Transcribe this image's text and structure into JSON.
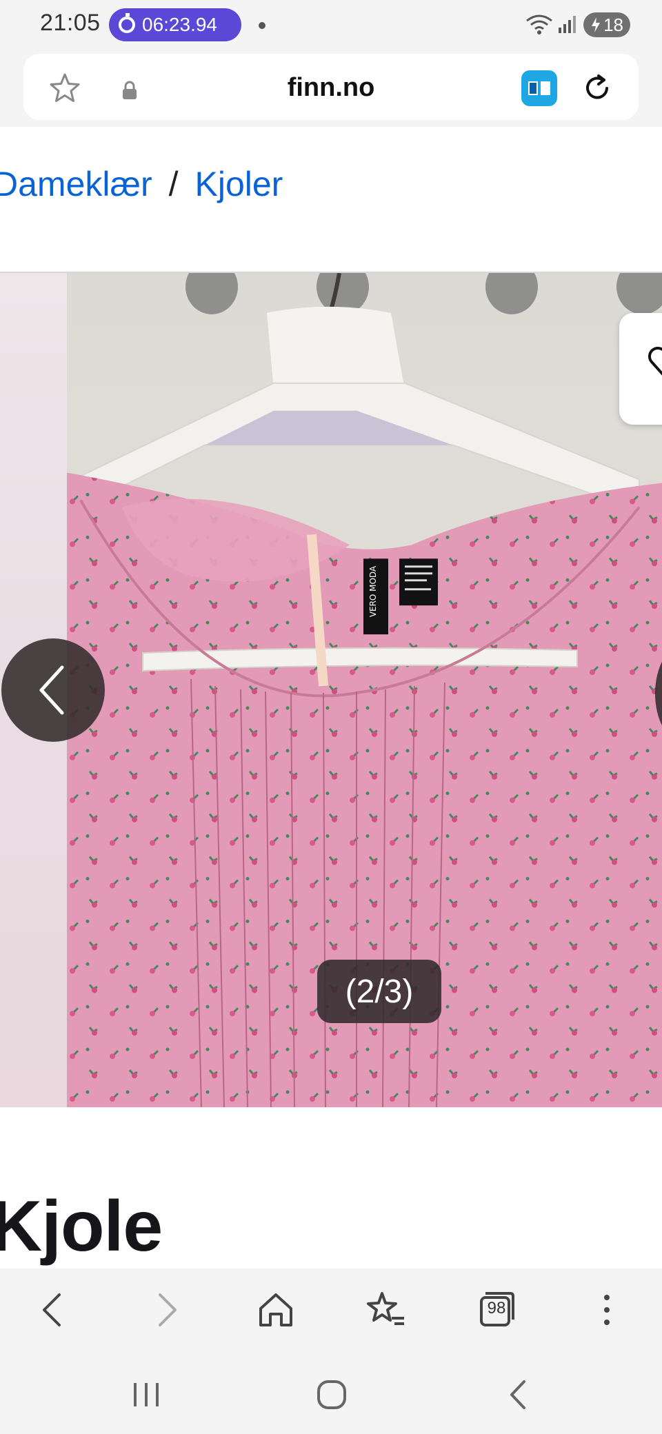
{
  "status_bar": {
    "time": "21:05",
    "timer": "06:23.94",
    "battery_level": "18",
    "icons": [
      "timer-icon",
      "wifi-icon",
      "signal-icon",
      "battery-icon"
    ]
  },
  "browser": {
    "url": "finn.no",
    "icons": [
      "star-icon",
      "lock-icon",
      "reader-mode-icon",
      "reload-icon"
    ]
  },
  "breadcrumb": {
    "items": [
      "Dameklær",
      "Kjoler"
    ],
    "separator": "/"
  },
  "gallery": {
    "counter": "(2/3)",
    "label_text": [
      "VERO MODA"
    ],
    "icons": [
      "favorite-heart-icon",
      "chevron-left-icon",
      "chevron-right-icon"
    ]
  },
  "listing": {
    "title": "Kjole"
  },
  "toolbar": {
    "tabs_count": "98",
    "icons": [
      "back-icon",
      "forward-icon",
      "home-icon",
      "bookmarks-icon",
      "tabs-icon",
      "more-icon"
    ]
  },
  "nav_bar": {
    "icons": [
      "recents-icon",
      "home-circle-icon",
      "system-back-icon"
    ]
  },
  "colors": {
    "link": "#0a63d6",
    "timer_pill": "#5b48d6",
    "reader_mode": "#1fa7e3",
    "dress_pink": "#e29bb6"
  }
}
